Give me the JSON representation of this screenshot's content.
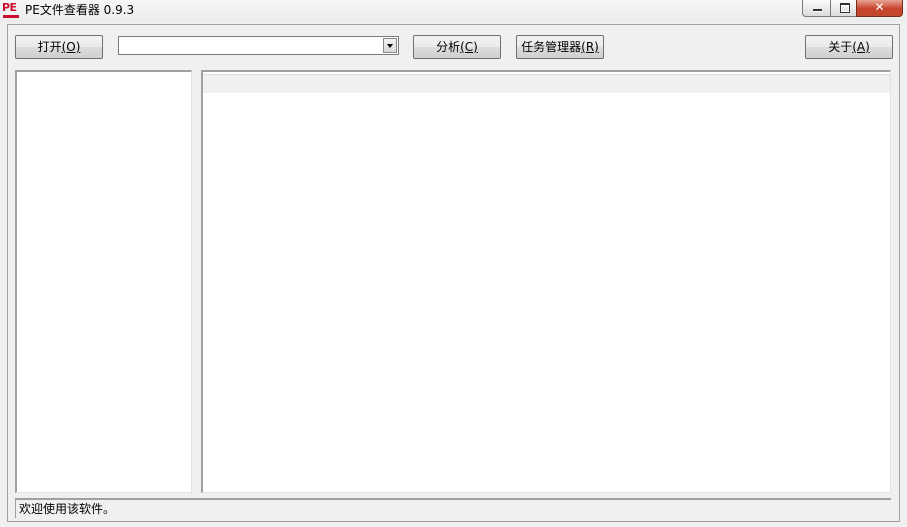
{
  "window": {
    "title": "PE文件查看器 0.9.3",
    "icon_text": "PE",
    "close_symbol": "✕"
  },
  "toolbar": {
    "open_label": "打开",
    "open_hotkey": "(O)",
    "analyze_label": "分析",
    "analyze_hotkey": "(C)",
    "taskmgr_label": "任务管理器",
    "taskmgr_hotkey": "(R)",
    "about_label": "关于",
    "about_hotkey": "(A)",
    "file_combo_value": ""
  },
  "status": {
    "text": "欢迎使用该软件。"
  },
  "colors": {
    "icon_red": "#c8102e",
    "close_red": "#c7432c",
    "window_bg": "#f0f0f0"
  }
}
